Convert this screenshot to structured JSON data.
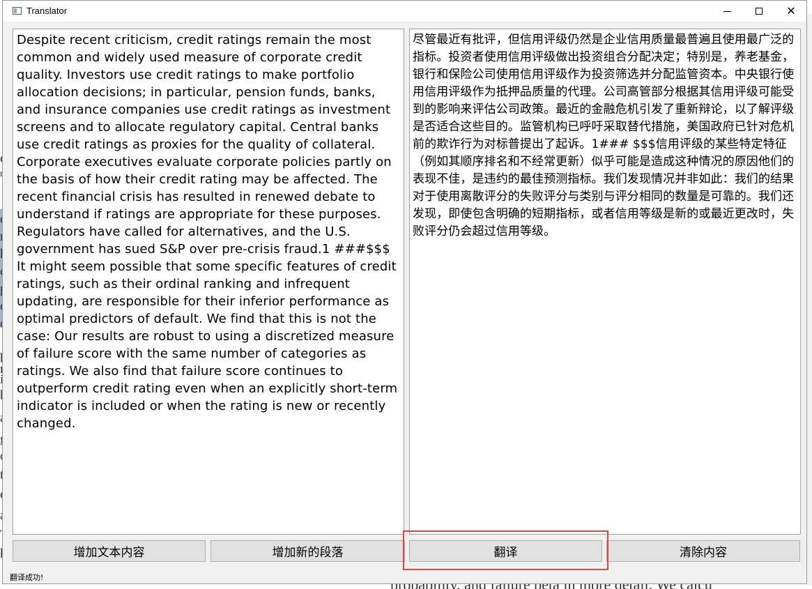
{
  "window": {
    "title": "Translator",
    "minimize": "—",
    "maximize": "☐",
    "close": "✕"
  },
  "source": {
    "text": "Despite recent criticism, credit ratings remain the most common and widely used measure of corporate credit quality. Investors use credit ratings to make portfolio allocation decisions; in particular, pension funds, banks, and insurance companies use credit ratings as investment screens and to allocate regulatory capital. Central banks use credit ratings as proxies for the quality of collateral. Corporate executives evaluate corporate policies partly on the basis of how their credit rating may be affected. The recent financial crisis has resulted in renewed debate to understand if ratings are appropriate for these purposes. Regulators have called for alternatives, and the U.S. government has sued S&P over pre-crisis fraud.1 ###$$$ It might seem possible that some specific features of credit ratings, such as their ordinal ranking and infrequent updating, are responsible for their inferior performance as optimal predictors of default. We find that this is not the case: Our results are robust to using a discretized measure of failure score with the same number of categories as ratings. We also find that failure score continues to outperform credit rating even when an explicitly short-term indicator is included or when the rating is new or recently changed."
  },
  "target": {
    "text": "尽管最近有批评，但信用评级仍然是企业信用质量最普遍且使用最广泛的指标。投资者使用信用评级做出投资组合分配决定；特别是，养老基金，银行和保险公司使用信用评级作为投资筛选并分配监管资本。中央银行使用信用评级作为抵押品质量的代理。公司高管部分根据其信用评级可能受到的影响来评估公司政策。最近的金融危机引发了重新辩论，以了解评级是否适合这些目的。监管机构已呼吁采取替代措施，美国政府已针对危机前的欺诈行为对标普提出了起诉。1### $$$信用评级的某些特定特征（例如其顺序排名和不经常更新）似乎可能是造成这种情况的原因他们的表现不佳，是违约的最佳预测指标。我们发现情况并非如此：我们的结果对于使用离散评分的失败评分与类别与评分相同的数量是可靠的。我们还发现，即使包含明确的短期指标，或者信用等级是新的或最近更改时，失败评分仍会超过信用等级。"
  },
  "buttons": {
    "add_text": "增加文本内容",
    "add_paragraph": "增加新的段落",
    "translate": "翻译",
    "clear": "清除内容"
  },
  "status": {
    "message": "翻译成功!"
  },
  "background": {
    "left_letters": [
      "e",
      "n",
      "d",
      "r",
      "h",
      "c",
      "p",
      "c",
      "o",
      "b",
      "n",
      "i",
      "b",
      "a",
      "g",
      "o",
      "t",
      "e",
      "a",
      "T",
      "h"
    ],
    "bottom_text": "probability, and failure beta in more detail. We calcu"
  },
  "colors": {
    "highlight": "#e8413e",
    "window_bg": "#f0f0f0",
    "button_bg": "#e1e1e1"
  }
}
